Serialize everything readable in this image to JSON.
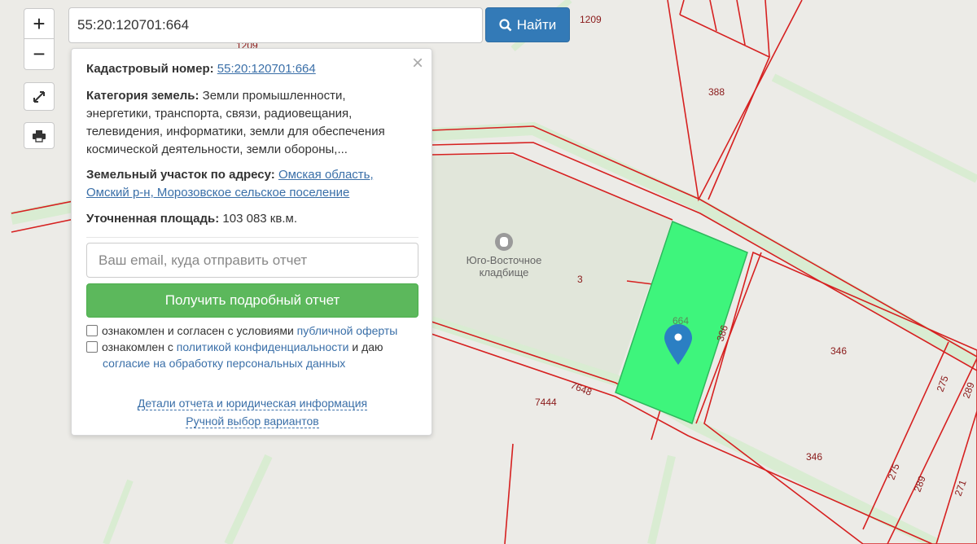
{
  "search": {
    "value": "55:20:120701:664",
    "button_label": "Найти"
  },
  "controls": {
    "zoom_in": "+",
    "zoom_out": "−"
  },
  "popup": {
    "close": "×",
    "cadastral_label": "Кадастровый номер:",
    "cadastral_value": "55:20:120701:664",
    "category_label": "Категория земель:",
    "category_value": "Земли промышленности, энергетики, транспорта, связи, радиовещания, телевидения, информатики, земли для обеспечения космической деятельности, земли обороны,...",
    "address_label": "Земельный участок по адресу:",
    "address_value": "Омская область, Омский р-н, Морозовское сельское поселение",
    "area_label": "Уточненная площадь:",
    "area_value": "103 083 кв.м.",
    "email_placeholder": "Ваш email, куда отправить отчет",
    "report_button": "Получить подробный отчет",
    "check1_text": "ознакомлен и согласен с условиями",
    "check1_link": "публичной оферты",
    "check2_text1": "ознакомлен с",
    "check2_link1": "политикой конфиденциальности",
    "check2_text2": "и даю",
    "check2_link2": "согласие на обработку персональных данных",
    "details_link": "Детали отчета и юридическая информация",
    "manual_link": "Ручной выбор вариантов"
  },
  "map": {
    "cemetery_line1": "Юго-Восточное",
    "cemetery_line2": "кладбище",
    "labels": {
      "l1209a": "1209",
      "l1209b": "1209",
      "l388": "388",
      "l3": "3",
      "l664": "664",
      "l386": "386",
      "l7648": "7648",
      "l7444": "7444",
      "l346a": "346",
      "l346b": "346",
      "l275a": "275",
      "l289a": "289",
      "l275b": "275",
      "l289b": "289",
      "l271": "271"
    },
    "highlight_color": "#3ef57c",
    "boundary_color": "#d62020"
  }
}
